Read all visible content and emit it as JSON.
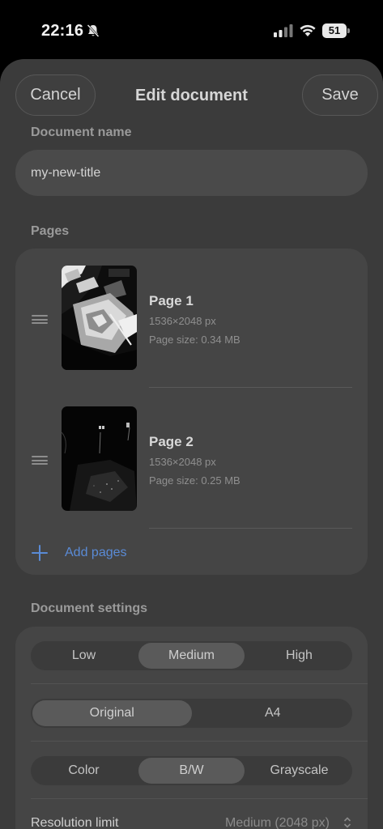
{
  "status": {
    "time": "22:16",
    "battery": "51",
    "icons": [
      "bell-slash-icon",
      "cellular-signal-icon",
      "wifi-icon",
      "battery-icon"
    ]
  },
  "header": {
    "cancel_label": "Cancel",
    "title": "Edit document",
    "save_label": "Save"
  },
  "document": {
    "name_label": "Document name",
    "name_value": "my-new-title"
  },
  "pages": {
    "label": "Pages",
    "items": [
      {
        "title": "Page 1",
        "dims": "1536×2048 px",
        "size": "Page size: 0.34 MB"
      },
      {
        "title": "Page 2",
        "dims": "1536×2048 px",
        "size": "Page size: 0.25 MB"
      }
    ],
    "add_label": "Add pages"
  },
  "settings": {
    "label": "Document settings",
    "quality": {
      "options": [
        "Low",
        "Medium",
        "High"
      ],
      "selected": "Medium"
    },
    "format": {
      "options": [
        "Original",
        "A4"
      ],
      "selected": "Original"
    },
    "color_mode": {
      "options": [
        "Color",
        "B/W",
        "Grayscale"
      ],
      "selected": "B/W"
    },
    "resolution": {
      "label": "Resolution limit",
      "value": "Medium (2048 px)"
    }
  },
  "colors": {
    "accent": "#5a8bd6",
    "sheet_bg": "#3b3b3b",
    "card_bg": "#454545"
  }
}
